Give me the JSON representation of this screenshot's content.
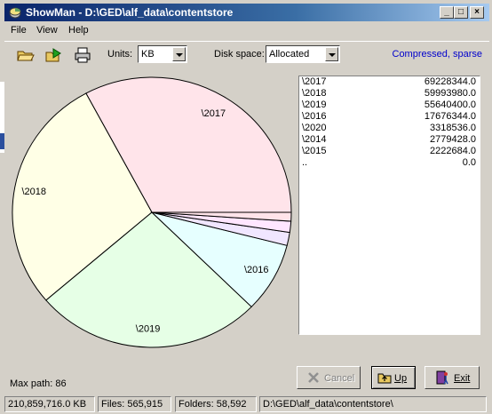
{
  "window": {
    "title": "ShowMan - D:\\GED\\alf_data\\contentstore",
    "min_glyph": "_",
    "max_glyph": "□",
    "close_glyph": "×"
  },
  "menu": [
    {
      "label": "File"
    },
    {
      "label": "View"
    },
    {
      "label": "Help"
    }
  ],
  "toolbar": {
    "units_label": "Units:",
    "units_value": "KB",
    "disk_space_label": "Disk space:",
    "disk_space_value": "Allocated",
    "compressed_text": "Compressed, sparse"
  },
  "chart_data": {
    "type": "pie",
    "slices": [
      {
        "label": "\\2017",
        "value": 69228344.0,
        "color": "#ffe4ea"
      },
      {
        "label": "\\2018",
        "value": 59993980.0,
        "color": "#ffffe6"
      },
      {
        "label": "\\2019",
        "value": 55640400.0,
        "color": "#e6ffe6"
      },
      {
        "label": "\\2016",
        "value": 17676344.0,
        "color": "#e6ffff"
      },
      {
        "label": "\\2020",
        "value": 3318536.0,
        "color": "#f0e6ff"
      },
      {
        "label": "\\2014",
        "value": 2779428.0,
        "color": "#ffe6ff"
      },
      {
        "label": "\\2015",
        "value": 2222684.0,
        "color": "#ffe4ea"
      },
      {
        "label": "..",
        "value": 0.0,
        "color": "#ffffff"
      }
    ]
  },
  "list": [
    {
      "name": "\\2017",
      "size": "69228344.0"
    },
    {
      "name": "\\2018",
      "size": "59993980.0"
    },
    {
      "name": "\\2019",
      "size": "55640400.0"
    },
    {
      "name": "\\2016",
      "size": "17676344.0"
    },
    {
      "name": "\\2020",
      "size": "3318536.0"
    },
    {
      "name": "\\2014",
      "size": "2779428.0"
    },
    {
      "name": "\\2015",
      "size": "2222684.0"
    },
    {
      "name": "..",
      "size": "0.0"
    }
  ],
  "max_path": "Max path: 86",
  "buttons": {
    "cancel": "Cancel",
    "up": "Up",
    "exit": "Exit"
  },
  "status": {
    "total": "210,859,716.0 KB",
    "files": "Files: 565,915",
    "folders": "Folders: 58,592",
    "path": "D:\\GED\\alf_data\\contentstore\\"
  }
}
